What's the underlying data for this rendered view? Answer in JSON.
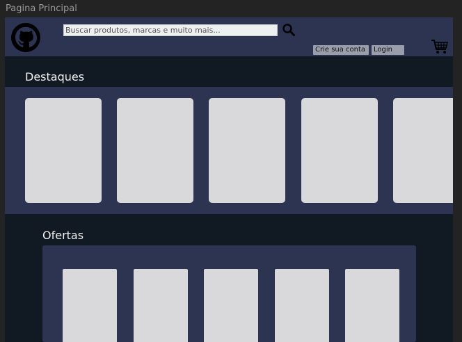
{
  "window": {
    "title": "Pagina Principal"
  },
  "header": {
    "logo": "github-logo-icon",
    "search": {
      "placeholder": "Buscar produtos, marcas e muito mais...",
      "value": ""
    },
    "search_icon": "search-icon",
    "signup_label": "Crie sua conta",
    "login_label": "Login",
    "cart_icon": "shopping-cart-icon"
  },
  "featured": {
    "title": "Destaques",
    "card_count": 5
  },
  "offers": {
    "title": "Ofertas",
    "card_count": 5
  },
  "colors": {
    "header_bg": "#2d3452",
    "page_bg": "#111a22",
    "card_bg": "#d9d9db",
    "outer_bg": "#232323"
  }
}
